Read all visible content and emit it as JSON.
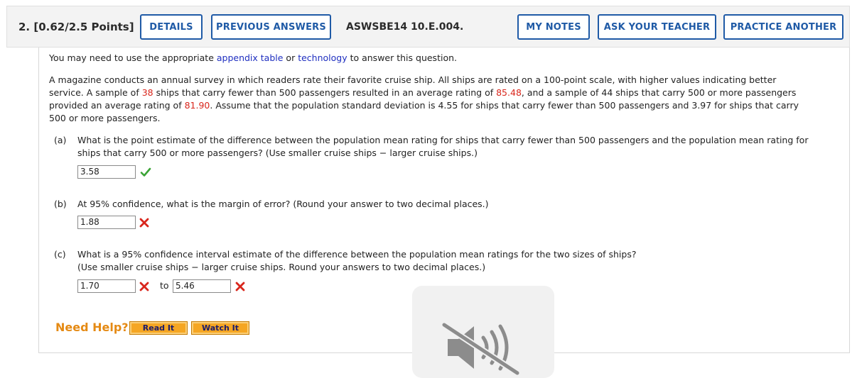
{
  "header": {
    "question_number": "2.",
    "points": "[0.62/2.5 Points]",
    "details_label": "DETAILS",
    "previous_answers_label": "PREVIOUS ANSWERS",
    "question_code": "ASWSBE14 10.E.004.",
    "my_notes_label": "MY NOTES",
    "ask_teacher_label": "ASK YOUR TEACHER",
    "practice_another_label": "PRACTICE ANOTHER"
  },
  "intro": {
    "prefix": "You may need to use the appropriate ",
    "appendix_link": "appendix table",
    "middle": " or ",
    "technology_link": "technology",
    "suffix": " to answer this question."
  },
  "problem": {
    "s1": "A magazine conducts an annual survey in which readers rate their favorite cruise ship. All ships are rated on a 100-point scale, with higher values indicating better",
    "s2a": "service. A sample of ",
    "n1": "38",
    "s2b": " ships that carry fewer than 500 passengers resulted in an average rating of ",
    "mean1": "85.48",
    "s2c": ", and a sample of 44 ships that carry 500 or more passengers",
    "s3a": "provided an average rating of ",
    "mean2": "81.90",
    "s3b": ". Assume that the population standard deviation is 4.55 for ships that carry fewer than 500 passengers and 3.97 for ships that carry",
    "s4": "500 or more passengers."
  },
  "part_a": {
    "label": "(a)",
    "line1": "What is the point estimate of the difference between the population mean rating for ships that carry fewer than 500 passengers and the population mean rating for",
    "line2": "ships that carry 500 or more passengers? (Use smaller cruise ships − larger cruise ships.)",
    "answer": "3.58",
    "status": "correct"
  },
  "part_b": {
    "label": "(b)",
    "line1": "At 95% confidence, what is the margin of error? (Round your answer to two decimal places.)",
    "answer": "1.88",
    "status": "incorrect"
  },
  "part_c": {
    "label": "(c)",
    "line1": "What is a 95% confidence interval estimate of the difference between the population mean ratings for the two sizes of ships?",
    "line2": "(Use smaller cruise ships − larger cruise ships. Round your answers to two decimal places.)",
    "lower": "1.70",
    "to_label": "to",
    "upper": "5.46",
    "status_lower": "incorrect",
    "status_upper": "incorrect"
  },
  "help": {
    "need_help": "Need Help?",
    "read_it": "Read It",
    "watch_it": "Watch It"
  },
  "colors": {
    "link_blue": "#1f5aa6",
    "highlight_red": "#d9261c",
    "correct_green": "#3aa335",
    "help_orange": "#e58a14"
  },
  "icons": {
    "correct": "check-icon",
    "incorrect": "x-icon",
    "overlay": "muted-speaker-icon"
  }
}
